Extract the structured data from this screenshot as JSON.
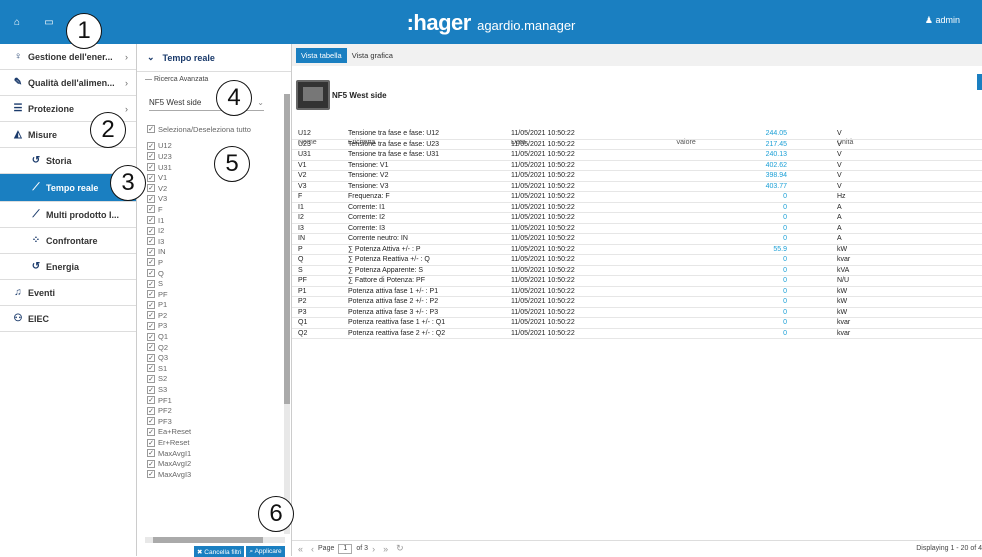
{
  "topbar": {
    "brand_logo": ":hager",
    "brand_app": "agardio.manager",
    "user": "admin"
  },
  "sidebar": {
    "items": [
      {
        "label": "Gestione dell'ener...",
        "icon": "bulb-icon",
        "has_chevron": true
      },
      {
        "label": "Qualità dell'alimen...",
        "icon": "wrench-icon",
        "has_chevron": true
      },
      {
        "label": "Protezione",
        "icon": "sliders-icon",
        "has_chevron": true
      },
      {
        "label": "Misure",
        "icon": "area-chart-icon",
        "has_chevron": false
      },
      {
        "label": "Storia",
        "icon": "history-icon",
        "sub": true
      },
      {
        "label": "Tempo reale",
        "icon": "line-chart-icon",
        "sub": true,
        "active": true
      },
      {
        "label": "Multi prodotto I...",
        "icon": "line-chart-icon",
        "sub": true
      },
      {
        "label": "Confrontare",
        "icon": "scatter-icon",
        "sub": true
      },
      {
        "label": "Energia",
        "icon": "history-icon",
        "sub": true
      },
      {
        "label": "Eventi",
        "icon": "bell-icon",
        "has_chevron": false
      },
      {
        "label": "EIEC",
        "icon": "hierarchy-icon",
        "has_chevron": false
      }
    ]
  },
  "panel": {
    "title": "Tempo reale",
    "advanced": "Ricerca Avanzata",
    "device_select": "NF5 West side",
    "select_all": "Seleziona/Deseleziona tutto",
    "checklist": [
      "U12",
      "U23",
      "U31",
      "V1",
      "V2",
      "V3",
      "F",
      "I1",
      "I2",
      "I3",
      "IN",
      "P",
      "Q",
      "S",
      "PF",
      "P1",
      "P2",
      "P3",
      "Q1",
      "Q2",
      "Q3",
      "S1",
      "S2",
      "S3",
      "PF1",
      "PF2",
      "PF3",
      "Ea+Reset",
      "Er+Reset",
      "MaxAvgI1",
      "MaxAvgI2",
      "MaxAvgI3"
    ],
    "btn_clear": "Cancella filtri",
    "btn_apply": "Applicare"
  },
  "main": {
    "tabs": [
      "Vista tabella",
      "Vista grafica"
    ],
    "device_name": "NF5 West side",
    "columns": [
      "Nome",
      "Etichetta",
      "Data",
      "Valore",
      "Unità"
    ],
    "rows": [
      [
        "U12",
        "Tensione tra fase e fase: U12",
        "11/05/2021 10:50:22",
        "244.05",
        "V"
      ],
      [
        "U23",
        "Tensione tra fase e fase: U23",
        "11/05/2021 10:50:22",
        "217.45",
        "V"
      ],
      [
        "U31",
        "Tensione tra fase e fase: U31",
        "11/05/2021 10:50:22",
        "240.13",
        "V"
      ],
      [
        "V1",
        "Tensione: V1",
        "11/05/2021 10:50:22",
        "402.62",
        "V"
      ],
      [
        "V2",
        "Tensione: V2",
        "11/05/2021 10:50:22",
        "398.94",
        "V"
      ],
      [
        "V3",
        "Tensione: V3",
        "11/05/2021 10:50:22",
        "403.77",
        "V"
      ],
      [
        "F",
        "Frequenza: F",
        "11/05/2021 10:50:22",
        "0",
        "Hz"
      ],
      [
        "I1",
        "Corrente: I1",
        "11/05/2021 10:50:22",
        "0",
        "A"
      ],
      [
        "I2",
        "Corrente: I2",
        "11/05/2021 10:50:22",
        "0",
        "A"
      ],
      [
        "I3",
        "Corrente: I3",
        "11/05/2021 10:50:22",
        "0",
        "A"
      ],
      [
        "IN",
        "Corrente neutro: IN",
        "11/05/2021 10:50:22",
        "0",
        "A"
      ],
      [
        "P",
        "∑ Potenza Attiva +/- : P",
        "11/05/2021 10:50:22",
        "55.9",
        "kW"
      ],
      [
        "Q",
        "∑ Potenza Reattiva +/- : Q",
        "11/05/2021 10:50:22",
        "0",
        "kvar"
      ],
      [
        "S",
        "∑ Potenza Apparente: S",
        "11/05/2021 10:50:22",
        "0",
        "kVA"
      ],
      [
        "PF",
        "∑ Fattore di Potenza: PF",
        "11/05/2021 10:50:22",
        "0",
        "N/U"
      ],
      [
        "P1",
        "Potenza attiva fase 1 +/- : P1",
        "11/05/2021 10:50:22",
        "0",
        "kW"
      ],
      [
        "P2",
        "Potenza attiva fase 2 +/- : P2",
        "11/05/2021 10:50:22",
        "0",
        "kW"
      ],
      [
        "P3",
        "Potenza attiva fase 3 +/- : P3",
        "11/05/2021 10:50:22",
        "0",
        "kW"
      ],
      [
        "Q1",
        "Potenza reattiva fase 1 +/- : Q1",
        "11/05/2021 10:50:22",
        "0",
        "kvar"
      ],
      [
        "Q2",
        "Potenza reattiva fase 2 +/- : Q2",
        "11/05/2021 10:50:22",
        "0",
        "kvar"
      ]
    ],
    "pager": {
      "page_label": "Page",
      "page_value": "1",
      "of_label": "of 3",
      "display": "Displaying 1 - 20 of 4"
    }
  },
  "callouts": [
    "1",
    "2",
    "3",
    "4",
    "5",
    "6"
  ],
  "colors": {
    "accent": "#1a7fc1",
    "value": "#1a9fd6"
  }
}
